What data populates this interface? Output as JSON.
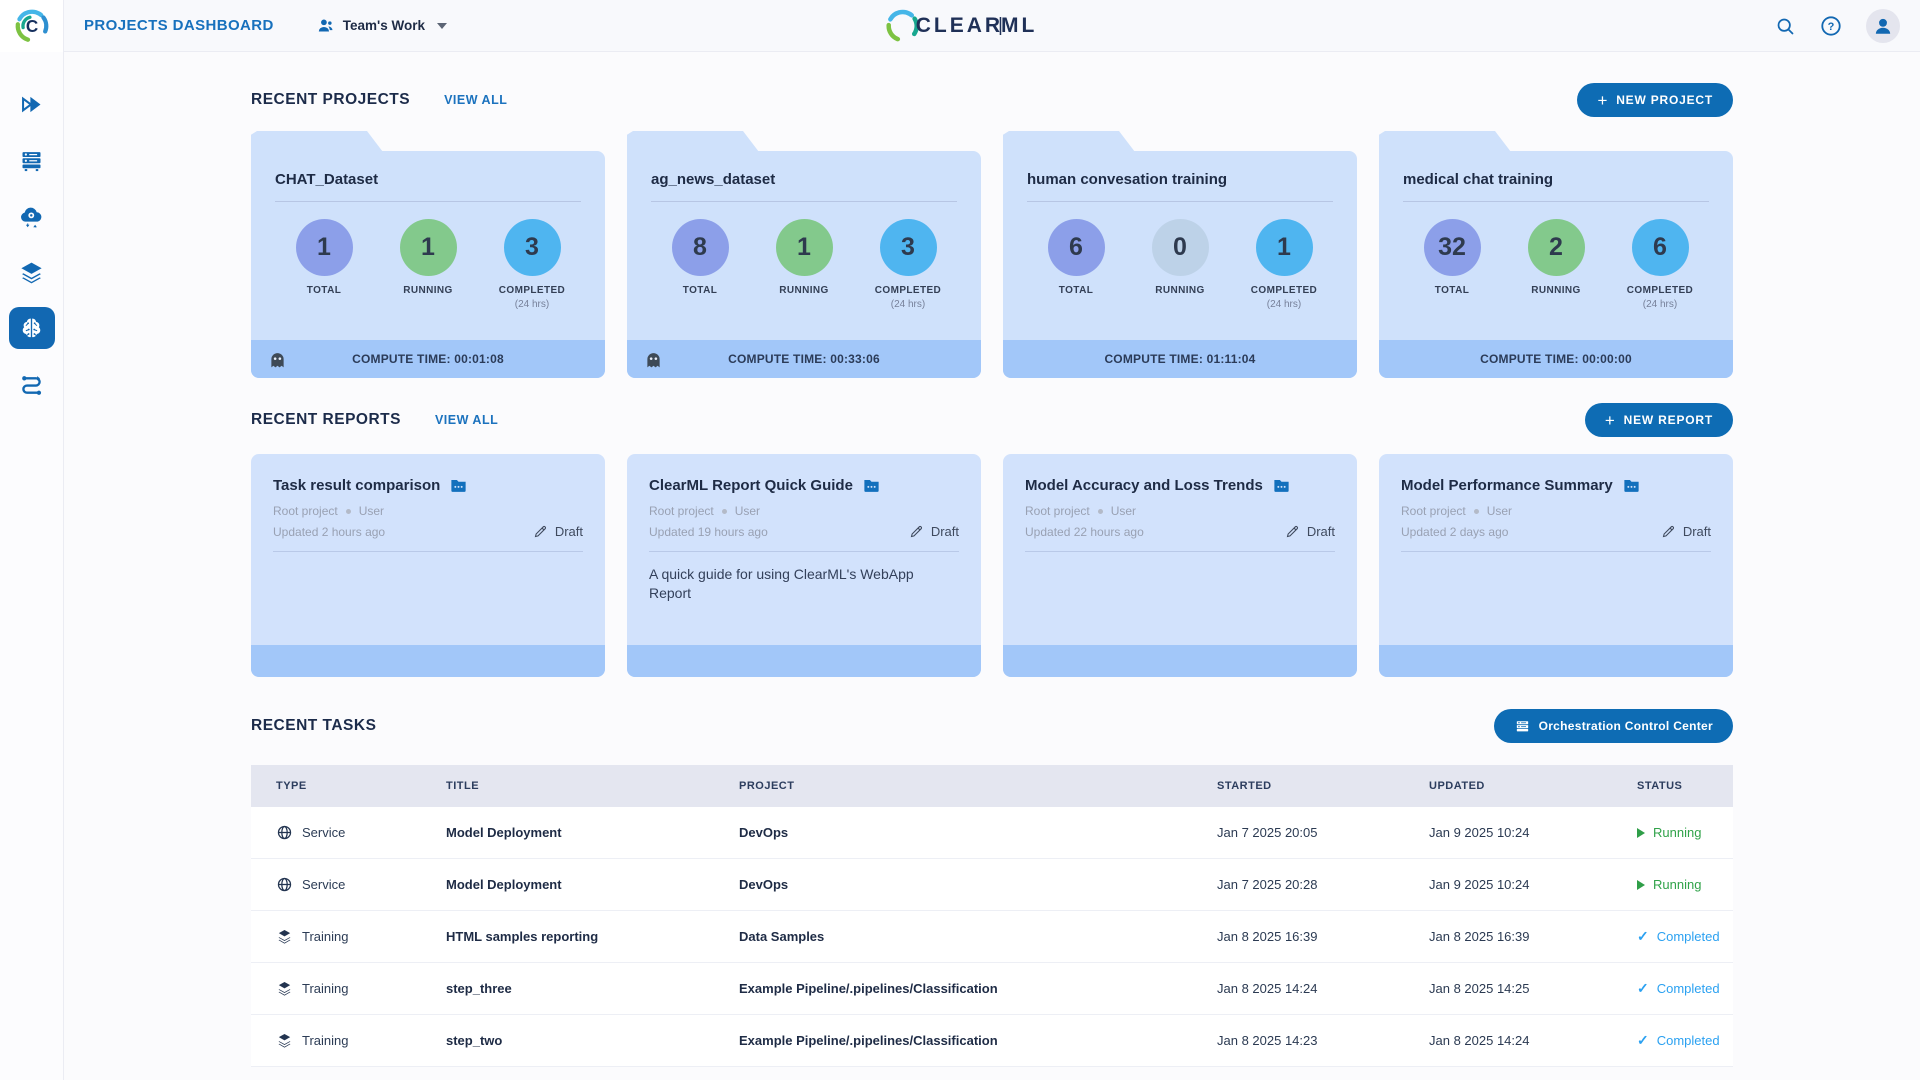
{
  "header": {
    "page_title": "PROJECTS DASHBOARD",
    "workspace": "Team's Work",
    "logo": {
      "part1": "CLEAR",
      "divider": "|",
      "part2": "ML"
    }
  },
  "sidebar": {
    "items": [
      {
        "icon": "double-chevron-icon",
        "active": false
      },
      {
        "icon": "workers-rack-icon",
        "active": false
      },
      {
        "icon": "cloud-autoscaler-icon",
        "active": false
      },
      {
        "icon": "datasets-layers-icon",
        "active": false
      },
      {
        "icon": "brain-icon",
        "active": true
      },
      {
        "icon": "pipelines-icon",
        "active": false
      }
    ]
  },
  "projects": {
    "section_title": "RECENT PROJECTS",
    "view_all": "VIEW ALL",
    "new_button": "NEW PROJECT",
    "stat_labels": {
      "total": "TOTAL",
      "running": "RUNNING",
      "completed": "COMPLETED",
      "completed_sub": "(24 hrs)"
    },
    "cards": [
      {
        "name": "CHAT_Dataset",
        "total": "1",
        "running": "1",
        "completed": "3",
        "compute_time": "COMPUTE TIME: 00:01:08",
        "has_ghost": true
      },
      {
        "name": "ag_news_dataset",
        "total": "8",
        "running": "1",
        "completed": "3",
        "compute_time": "COMPUTE TIME: 00:33:06",
        "has_ghost": true
      },
      {
        "name": "human convesation training",
        "total": "6",
        "running": "0",
        "completed": "1",
        "compute_time": "COMPUTE TIME: 01:11:04",
        "has_ghost": false
      },
      {
        "name": "medical chat training",
        "total": "32",
        "running": "2",
        "completed": "6",
        "compute_time": "COMPUTE TIME: 00:00:00",
        "has_ghost": false
      }
    ]
  },
  "reports": {
    "section_title": "RECENT REPORTS",
    "view_all": "VIEW ALL",
    "new_button": "NEW REPORT",
    "cards": [
      {
        "title": "Task result comparison",
        "project": "Root project",
        "user": "User",
        "updated": "Updated 2 hours ago",
        "status": "Draft",
        "description": ""
      },
      {
        "title": "ClearML Report Quick Guide",
        "project": "Root project",
        "user": "User",
        "updated": "Updated 19 hours ago",
        "status": "Draft",
        "description": "A quick guide for using ClearML's WebApp Report"
      },
      {
        "title": "Model Accuracy and Loss Trends",
        "project": "Root project",
        "user": "User",
        "updated": "Updated 22 hours ago",
        "status": "Draft",
        "description": ""
      },
      {
        "title": "Model Performance Summary",
        "project": "Root project",
        "user": "User",
        "updated": "Updated 2 days ago",
        "status": "Draft",
        "description": ""
      }
    ]
  },
  "tasks": {
    "section_title": "RECENT TASKS",
    "orchestration_button": "Orchestration Control Center",
    "columns": {
      "type": "TYPE",
      "title": "TITLE",
      "project": "PROJECT",
      "started": "STARTED",
      "updated": "UPDATED",
      "status": "STATUS"
    },
    "rows": [
      {
        "type": "Service",
        "title": "Model Deployment",
        "project": "DevOps",
        "started": "Jan 7 2025 20:05",
        "updated": "Jan 9 2025 10:24",
        "status": "Running"
      },
      {
        "type": "Service",
        "title": "Model Deployment",
        "project": "DevOps",
        "started": "Jan 7 2025 20:28",
        "updated": "Jan 9 2025 10:24",
        "status": "Running"
      },
      {
        "type": "Training",
        "title": "HTML samples reporting",
        "project": "Data Samples",
        "started": "Jan 8 2025 16:39",
        "updated": "Jan 8 2025 16:39",
        "status": "Completed"
      },
      {
        "type": "Training",
        "title": "step_three",
        "project": "Example Pipeline/.pipelines/Classification",
        "started": "Jan 8 2025 14:24",
        "updated": "Jan 8 2025 14:25",
        "status": "Completed"
      },
      {
        "type": "Training",
        "title": "step_two",
        "project": "Example Pipeline/.pipelines/Classification",
        "started": "Jan 8 2025 14:23",
        "updated": "Jan 8 2025 14:24",
        "status": "Completed"
      }
    ]
  },
  "colors": {
    "primary_blue": "#0e6cb4",
    "link_blue": "#1b72be",
    "navy_text": "#1e2b45",
    "card_blue": "#cfe1fb",
    "card_footer_blue": "#a2c7f9",
    "circle_total": "#8c9fe9",
    "circle_running": "#83c98c",
    "circle_running_zero": "#bdd2e8",
    "circle_completed": "#4fb5f0",
    "status_running_green": "#31a34a",
    "status_completed_blue": "#2ba1f1",
    "table_header_bg": "#e4e6f0",
    "page_bg": "#fbfbfd"
  }
}
